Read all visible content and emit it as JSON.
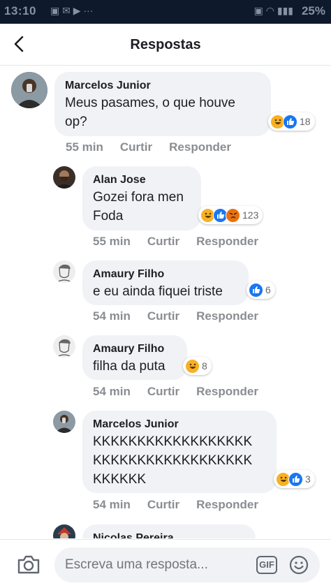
{
  "status_bar": {
    "time": "13:10",
    "battery": "25%"
  },
  "header": {
    "title": "Respostas"
  },
  "comments": [
    {
      "author": "Marcelos Junior",
      "text": "Meus pasames, o que houve\nop?",
      "reactions": [
        "haha",
        "like"
      ],
      "reaction_count": "18",
      "time": "55 min",
      "like_label": "Curtir",
      "reply_label": "Responder"
    },
    {
      "author": "Alan Jose",
      "text": "Gozei fora men\nFoda",
      "reactions": [
        "haha",
        "like",
        "angry"
      ],
      "reaction_count": "123",
      "time": "55 min",
      "like_label": "Curtir",
      "reply_label": "Responder"
    },
    {
      "author": "Amaury Filho",
      "text": "e eu ainda fiquei triste",
      "reactions": [
        "like"
      ],
      "reaction_count": "6",
      "time": "54 min",
      "like_label": "Curtir",
      "reply_label": "Responder"
    },
    {
      "author": "Amaury Filho",
      "text": "filha da puta",
      "reactions": [
        "haha"
      ],
      "reaction_count": "8",
      "time": "54 min",
      "like_label": "Curtir",
      "reply_label": "Responder"
    },
    {
      "author": "Marcelos Junior",
      "text": "KKKKKKKKKKKKKKKKKK\nKKKKKKKKKKKKKKKKKK\nKKKKKK",
      "reactions": [
        "haha",
        "like"
      ],
      "reaction_count": "3",
      "time": "54 min",
      "like_label": "Curtir",
      "reply_label": "Responder"
    },
    {
      "author": "Nicolas Pereira"
    }
  ],
  "composer": {
    "placeholder": "Escreva uma resposta...",
    "gif_label": "GIF"
  },
  "colors": {
    "status_bar_bg": "#0e1a2b",
    "bubble_bg": "#f0f2f5",
    "like_blue": "#1877f2",
    "haha_yellow": "#f7b125",
    "angry_orange": "#e9710f",
    "meta_gray": "#8a8d91"
  }
}
